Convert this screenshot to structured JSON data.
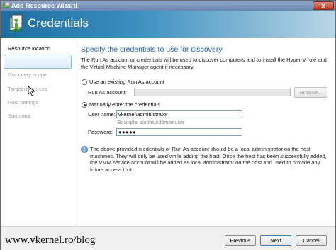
{
  "window": {
    "title": "Add Resource Wizard",
    "close_glyph": "X"
  },
  "banner": {
    "title": "Credentials"
  },
  "sidebar": {
    "items": [
      {
        "label": "Resource location",
        "active": true
      },
      {
        "label": "Discovery scope",
        "active": false
      },
      {
        "label": "Target resources",
        "active": false
      },
      {
        "label": "Host settings",
        "active": false
      },
      {
        "label": "Summary",
        "active": false
      }
    ]
  },
  "main": {
    "heading": "Specify the credentials to use for discovery",
    "description": "The Run As account or credentials will be used to discover computers and to install the Hyper-V role and the Virtual Machine Manager agent if necessary.",
    "option_existing": {
      "label": "Use an existing Run As account",
      "selected": false
    },
    "run_as_label": "Run As account:",
    "run_as_value": "",
    "browse_label": "Browse...",
    "option_manual": {
      "label": "Manually enter the credentials",
      "selected": true
    },
    "username_label": "User name:",
    "username_value": "vkernel\\administrator",
    "username_example": "Example: contoso\\domainuser",
    "password_label": "Password:",
    "password_value": "●●●●●",
    "info_glyph": "i",
    "note": "The above provided credentials or Run As account should be a local administrator on the host machines. They will only be used while adding the host. Once the host has been successfully added, the VMM service account will be added as local administrator on the host and used to provide any future access to it."
  },
  "footer": {
    "previous_label": "Previous",
    "next_label": "Next",
    "cancel_label": "Cancel",
    "watermark": "www.vkernel.ro/blog"
  },
  "colors": {
    "heading": "#1e5fa8",
    "banner_start": "#1e6da1",
    "banner_end": "#b9d6e6"
  }
}
